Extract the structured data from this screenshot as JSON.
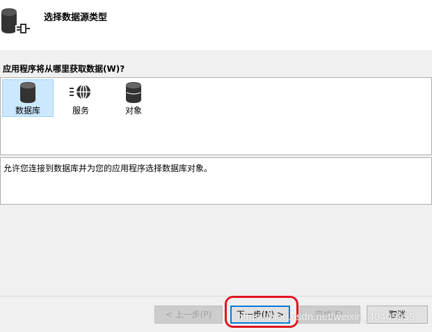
{
  "header": {
    "title": "选择数据源类型",
    "icon": "database-plug-icon"
  },
  "prompt": "应用程序将从哪里获取数据(W)?",
  "source_types": [
    {
      "label": "数据库",
      "icon": "database-icon",
      "selected": true
    },
    {
      "label": "服务",
      "icon": "service-globe-icon",
      "selected": false
    },
    {
      "label": "对象",
      "icon": "object-icon",
      "selected": false
    }
  ],
  "description": "允许您连接到数据库并为您的应用程序选择数据库对象。",
  "buttons": {
    "previous": "< 上一步(P)",
    "next": "下一步(N) >",
    "finish": "完成(F)",
    "cancel": "取消"
  },
  "watermark": "https://blog.csdn.net/weixin_40405955",
  "colors": {
    "selection": "#cce8ff",
    "highlight_ring": "#e0141e",
    "primary_border": "#0078d7"
  }
}
